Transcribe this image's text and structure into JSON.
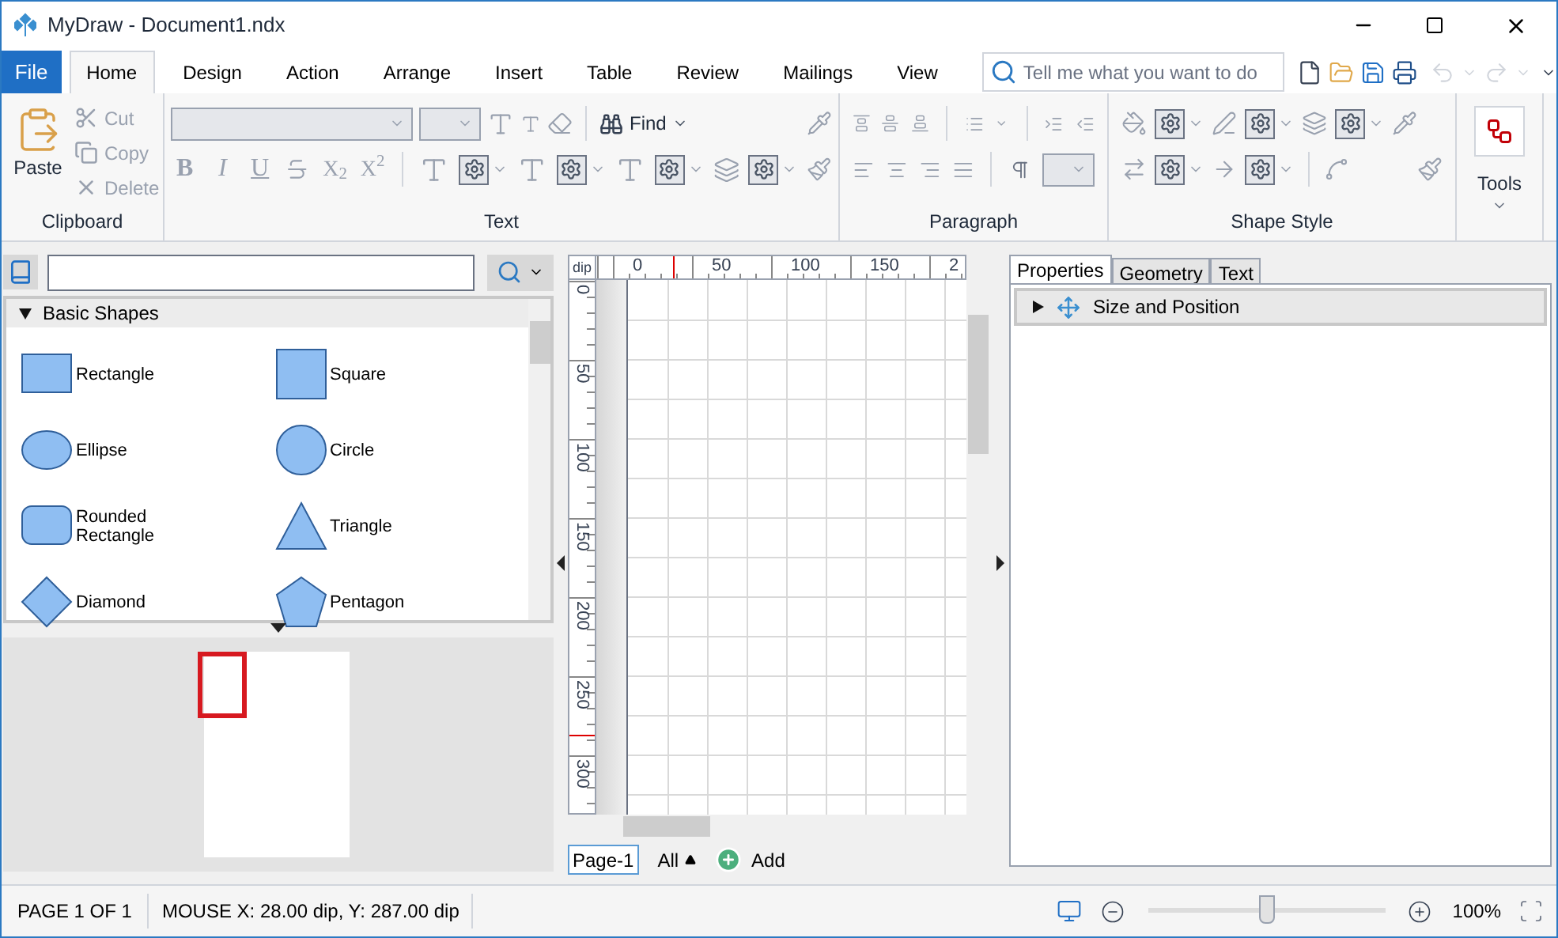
{
  "window": {
    "title": "MyDraw - Document1.ndx"
  },
  "file_tab": {
    "label": "File"
  },
  "tabs": [
    {
      "label": "Home",
      "selected": true
    },
    {
      "label": "Design",
      "selected": false
    },
    {
      "label": "Action",
      "selected": false
    },
    {
      "label": "Arrange",
      "selected": false
    },
    {
      "label": "Insert",
      "selected": false
    },
    {
      "label": "Table",
      "selected": false
    },
    {
      "label": "Review",
      "selected": false
    },
    {
      "label": "Mailings",
      "selected": false
    },
    {
      "label": "View",
      "selected": false
    }
  ],
  "search": {
    "placeholder": "Tell me what you want to do"
  },
  "ribbon": {
    "clipboard": {
      "label": "Clipboard",
      "paste": "Paste",
      "items": [
        {
          "kind": "cut",
          "label": "Cut",
          "disabled": true
        },
        {
          "kind": "copy",
          "label": "Copy",
          "disabled": true
        },
        {
          "kind": "delete",
          "label": "Delete",
          "disabled": true
        }
      ]
    },
    "text": {
      "label": "Text",
      "find": "Find",
      "format_buttons": [
        {
          "kind": "bold",
          "label": "B"
        },
        {
          "kind": "italic",
          "label": "I"
        },
        {
          "kind": "underline",
          "label": "U"
        },
        {
          "kind": "strike"
        },
        {
          "kind": "script",
          "label": "X$_{2}$"
        },
        {
          "kind": "script",
          "label": "X$^{2}$"
        }
      ]
    },
    "paragraph": {
      "label": "Paragraph"
    },
    "shape_style": {
      "label": "Shape Style"
    },
    "tools": {
      "label": "Tools"
    }
  },
  "shapes_panel": {
    "title": "Basic Shapes",
    "expanded": true,
    "shapes": [
      {
        "kind": "rectangle",
        "label": "Rectangle"
      },
      {
        "kind": "square",
        "label": "Square"
      },
      {
        "kind": "ellipse",
        "label": "Ellipse"
      },
      {
        "kind": "circle",
        "label": "Circle"
      },
      {
        "kind": "rounded",
        "label": "Rounded Rectangle"
      },
      {
        "kind": "triangle",
        "label": "Triangle"
      },
      {
        "kind": "diamond",
        "label": "Diamond"
      },
      {
        "kind": "pentagon",
        "label": "Pentagon"
      }
    ]
  },
  "ruler": {
    "unit": "dip",
    "x_labels": [
      "0",
      "50",
      "100",
      "150",
      "2"
    ],
    "y_labels": [
      "0",
      "50",
      "100",
      "150",
      "200",
      "250",
      "300"
    ]
  },
  "pages": {
    "tabs": [
      {
        "label": "Page-1",
        "selected": true
      }
    ],
    "filter": "All",
    "add": "Add"
  },
  "properties": {
    "tabs": [
      {
        "label": "Properties",
        "selected": true
      },
      {
        "label": "Geometry",
        "selected": false
      },
      {
        "label": "Text",
        "selected": false
      }
    ],
    "sections": [
      {
        "label": "Size and Position",
        "expanded": false
      }
    ]
  },
  "status_bar": {
    "page": "PAGE 1 OF 1",
    "mouse": "MOUSE X: 28.00 dip, Y: 287.00 dip",
    "zoom": "100%",
    "zoom_slider": {
      "level": 0.5
    }
  }
}
